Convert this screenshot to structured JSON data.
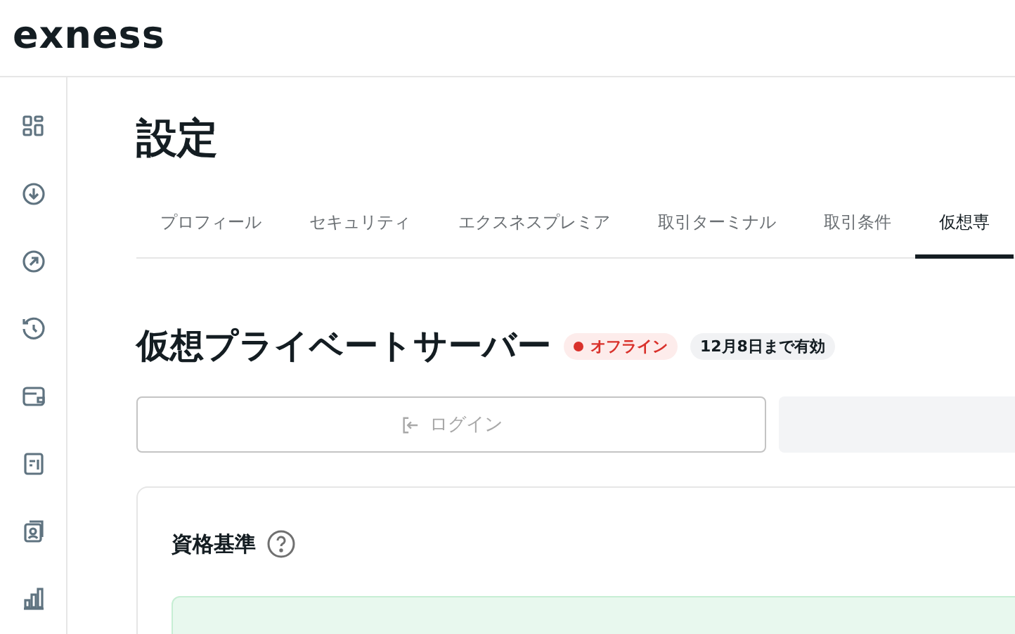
{
  "header": {
    "logo": "exness"
  },
  "sidebar": {
    "items": [
      {
        "selected": false
      },
      {
        "selected": false
      },
      {
        "selected": false
      },
      {
        "selected": false
      },
      {
        "selected": false
      },
      {
        "selected": false
      },
      {
        "selected": false
      },
      {
        "selected": false
      }
    ]
  },
  "page": {
    "title": "設定"
  },
  "tabs": [
    {
      "label": "プロフィール",
      "selected": false
    },
    {
      "label": "セキュリティ",
      "selected": false
    },
    {
      "label": "エクスネスプレミア",
      "selected": false
    },
    {
      "label": "取引ターミナル",
      "selected": false
    },
    {
      "label": "取引条件",
      "selected": false
    },
    {
      "label": "仮想専",
      "selected": true
    }
  ],
  "section": {
    "title": "仮想プライベートサーバー",
    "status": {
      "label": "オフライン",
      "color": "#d9312b"
    },
    "validity": "12月8日まで有効"
  },
  "actions": [
    {
      "kind": "login",
      "label": "ログイン",
      "disabled": true
    },
    {
      "kind": "blank",
      "disabled": true
    }
  ],
  "card": {
    "title": "資格基準"
  }
}
